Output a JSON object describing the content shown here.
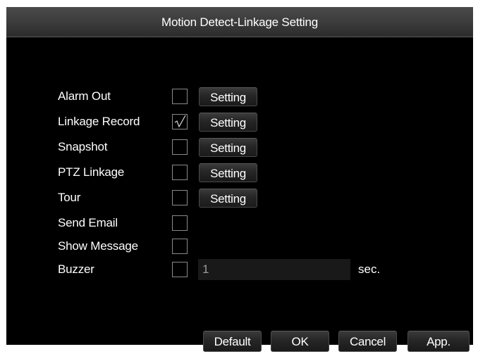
{
  "window": {
    "title": "Motion Detect-Linkage Setting"
  },
  "rows": [
    {
      "label": "Alarm Out",
      "checked": false,
      "setting_label": "Setting"
    },
    {
      "label": "Linkage Record",
      "checked": true,
      "setting_label": "Setting"
    },
    {
      "label": "Snapshot",
      "checked": false,
      "setting_label": "Setting"
    },
    {
      "label": "PTZ Linkage",
      "checked": false,
      "setting_label": "Setting"
    },
    {
      "label": "Tour",
      "checked": false,
      "setting_label": "Setting"
    },
    {
      "label": "Send Email",
      "checked": false
    },
    {
      "label": "Show Message",
      "checked": false
    },
    {
      "label": "Buzzer",
      "checked": false
    }
  ],
  "buzzer": {
    "value": "1",
    "unit": "sec."
  },
  "footer": {
    "default_label": "Default",
    "ok_label": "OK",
    "cancel_label": "Cancel",
    "apply_label": "App."
  },
  "colors": {
    "background": "#000000",
    "text": "#ffffff",
    "input_bg": "#191919"
  }
}
